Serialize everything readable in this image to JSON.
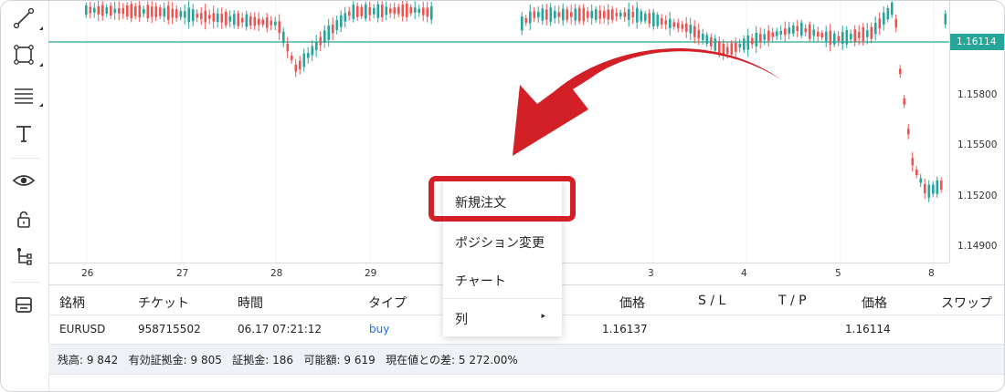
{
  "toolbar": {
    "tools": [
      "trend-line-tool",
      "rectangle-tool",
      "fib-levels-tool",
      "text-tool",
      "eye-tool",
      "lock-tool",
      "object-tree-tool",
      "panel-toggle-tool"
    ]
  },
  "chart": {
    "current_price": "1.16114",
    "price_labels": [
      "1.15800",
      "1.15500",
      "1.15200",
      "1.14900"
    ],
    "time_labels": [
      "26",
      "27",
      "28",
      "29",
      "3",
      "4",
      "5",
      "8"
    ],
    "colors": {
      "up": "#26a69a",
      "down": "#ef5350",
      "price_line": "#26a69a",
      "highlight": "#d31f26"
    }
  },
  "context_menu": {
    "items": [
      "新規注文",
      "ポジション変更",
      "チャート",
      "列"
    ],
    "submenu_arrow": "▸"
  },
  "positions": {
    "headers": [
      "銘柄",
      "チケット",
      "時間",
      "タイプ",
      "価格",
      "S / L",
      "T / P",
      "価格",
      "スワップ"
    ],
    "rows": [
      {
        "symbol": "EURUSD",
        "ticket": "958715502",
        "time": "06.17 07:21:12",
        "type": "buy",
        "open_price": "1.16137",
        "sl": "",
        "tp": "",
        "price": "1.16114",
        "swap": ""
      }
    ],
    "summary": "残高: 9 842   有効証拠金: 9 805   証拠金: 186   可能額: 9 619   現在値との差: 5 272.00%"
  }
}
